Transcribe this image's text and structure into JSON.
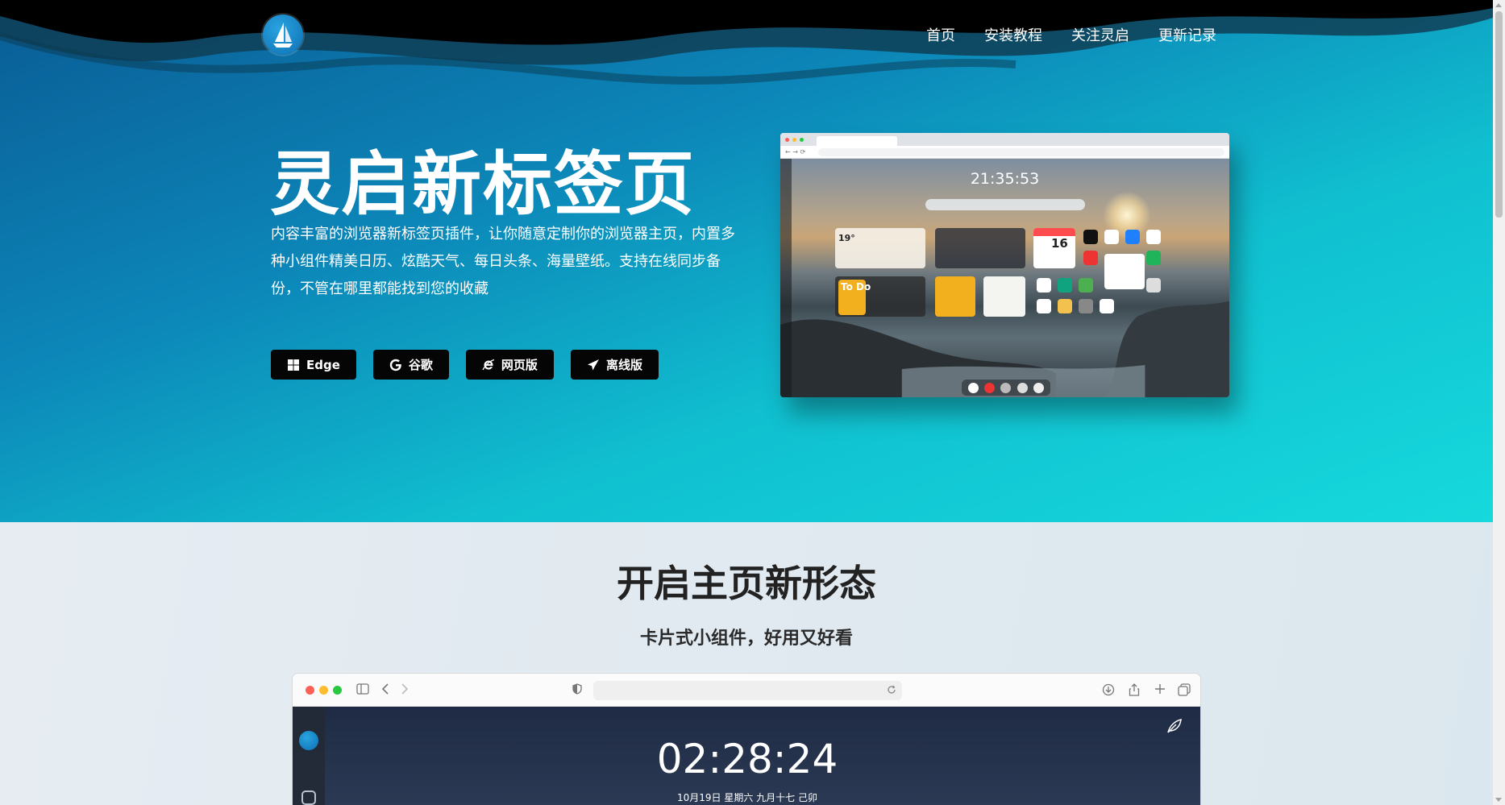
{
  "nav": {
    "items": [
      {
        "label": "首页"
      },
      {
        "label": "安装教程"
      },
      {
        "label": "关注灵启"
      },
      {
        "label": "更新记录"
      }
    ]
  },
  "hero": {
    "title": "灵启新标签页",
    "description": "内容丰富的浏览器新标签页插件，让你随意定制你的浏览器主页，内置多种小组件精美日历、炫酷天气、每日头条、海量壁纸。支持在线同步备份，不管在哪里都能找到您的收藏",
    "buttons": [
      {
        "label": "Edge",
        "icon": "windows-icon"
      },
      {
        "label": "谷歌",
        "icon": "google-icon"
      },
      {
        "label": "网页版",
        "icon": "ie-icon"
      },
      {
        "label": "离线版",
        "icon": "paper-plane-icon"
      }
    ],
    "preview": {
      "time": "21:35:53",
      "temperature": "19°",
      "calendar_day": "16",
      "todo_label": "To Do"
    }
  },
  "section2": {
    "title": "开启主页新形态",
    "subtitle": "卡片式小组件，好用又好看",
    "demo": {
      "clock": "02:28:24",
      "date": "10月19日  星期六  九月十七  己卯"
    }
  },
  "colors": {
    "hero_start": "#0a5c95",
    "hero_end": "#16d9dc",
    "button_bg": "#050505"
  }
}
